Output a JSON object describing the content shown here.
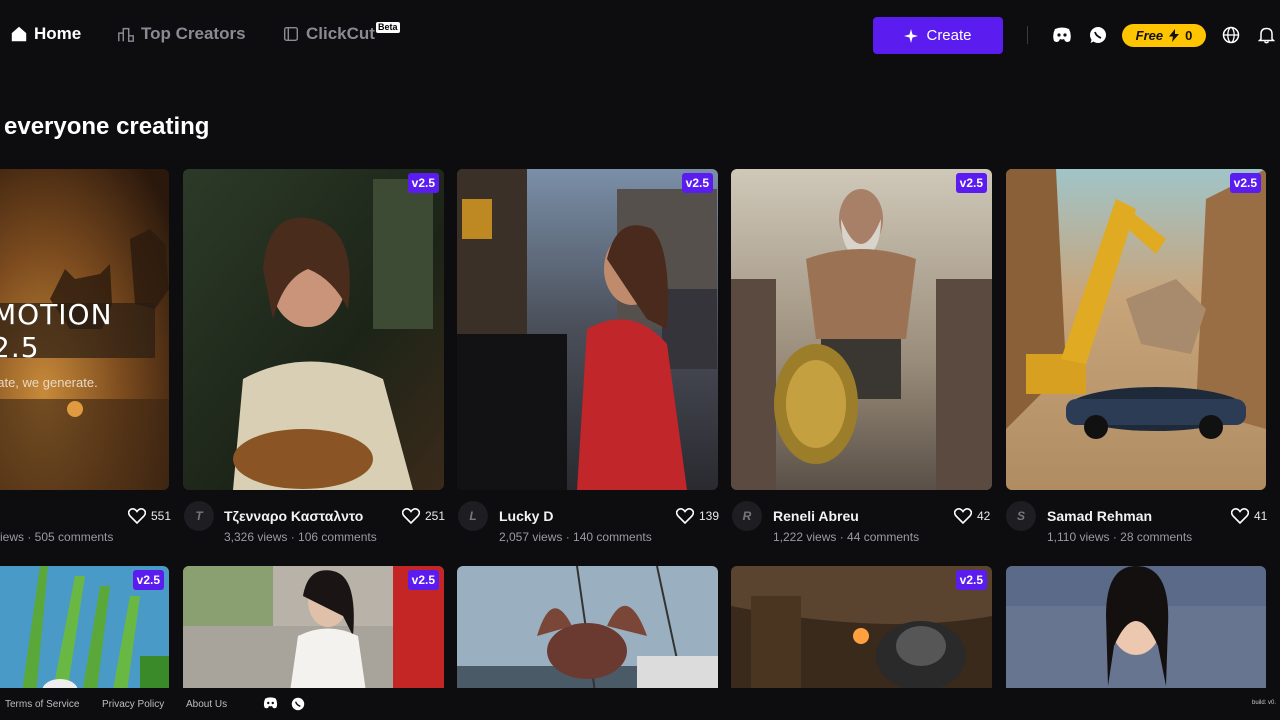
{
  "nav": {
    "home": "Home",
    "top_creators": "Top Creators",
    "clickcut": "ClickCut",
    "beta": "Beta",
    "create": "Create",
    "free": "Free",
    "credits": "0"
  },
  "headline": "everyone creating",
  "promo": {
    "title": "MOTION 2.5",
    "subtitle": "eate, we generate."
  },
  "cards": [
    {
      "badge": "",
      "avatar": "",
      "author": "",
      "stats": "iews · 505 comments",
      "likes": "551"
    },
    {
      "badge": "v2.5",
      "avatar": "T",
      "author": "Τζενναρο Κασταλντο",
      "stats": "3,326 views · 106 comments",
      "likes": "251"
    },
    {
      "badge": "v2.5",
      "avatar": "L",
      "author": "Lucky D",
      "stats": "2,057 views · 140 comments",
      "likes": "139"
    },
    {
      "badge": "v2.5",
      "avatar": "R",
      "author": "Reneli Abreu",
      "stats": "1,222 views · 44 comments",
      "likes": "42"
    },
    {
      "badge": "v2.5",
      "avatar": "S",
      "author": "Samad Rehman",
      "stats": "1,110 views · 28 comments",
      "likes": "41"
    }
  ],
  "row2_badges": [
    "v2.5",
    "v2.5",
    "",
    "v2.5",
    ""
  ],
  "footer": {
    "terms": "Terms of Service",
    "privacy": "Privacy Policy",
    "about": "About Us",
    "build": "build: v0."
  },
  "colors": {
    "background": "#0d0d0f",
    "accent": "#5b1cf0",
    "free_badge": "#ffc400"
  },
  "icons": [
    "home-icon",
    "top-creators-icon",
    "clickcut-icon",
    "sparkle-icon",
    "discord-icon",
    "whatsapp-icon",
    "bolt-icon",
    "globe-icon",
    "bell-icon",
    "heart-icon"
  ]
}
